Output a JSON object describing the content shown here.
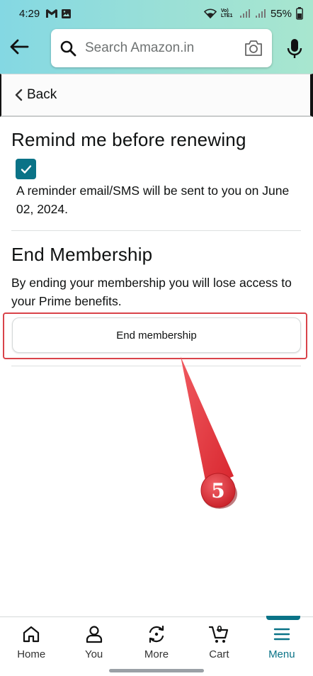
{
  "status_bar": {
    "time": "4:29",
    "network": "Vo) LTE1",
    "battery": "55%"
  },
  "search": {
    "placeholder": "Search Amazon.in"
  },
  "back": {
    "label": "Back"
  },
  "remind": {
    "heading": "Remind me before renewing",
    "checked": true,
    "text": "A reminder email/SMS will be sent to you on June 02, 2024."
  },
  "end_membership": {
    "heading": "End Membership",
    "description": "By ending your membership you will lose access to your Prime benefits.",
    "button_label": "End membership"
  },
  "annotation": {
    "step_number": "5",
    "color": "#e8323a"
  },
  "bottom_nav": {
    "items": [
      {
        "label": "Home",
        "icon": "home-icon"
      },
      {
        "label": "You",
        "icon": "user-icon"
      },
      {
        "label": "More",
        "icon": "more-icon"
      },
      {
        "label": "Cart",
        "icon": "cart-icon",
        "count": "0"
      },
      {
        "label": "Menu",
        "icon": "menu-icon",
        "active": true
      }
    ]
  },
  "colors": {
    "accent": "#0a7387",
    "header_gradient_start": "#84d8e3",
    "header_gradient_end": "#a8e6cf"
  }
}
